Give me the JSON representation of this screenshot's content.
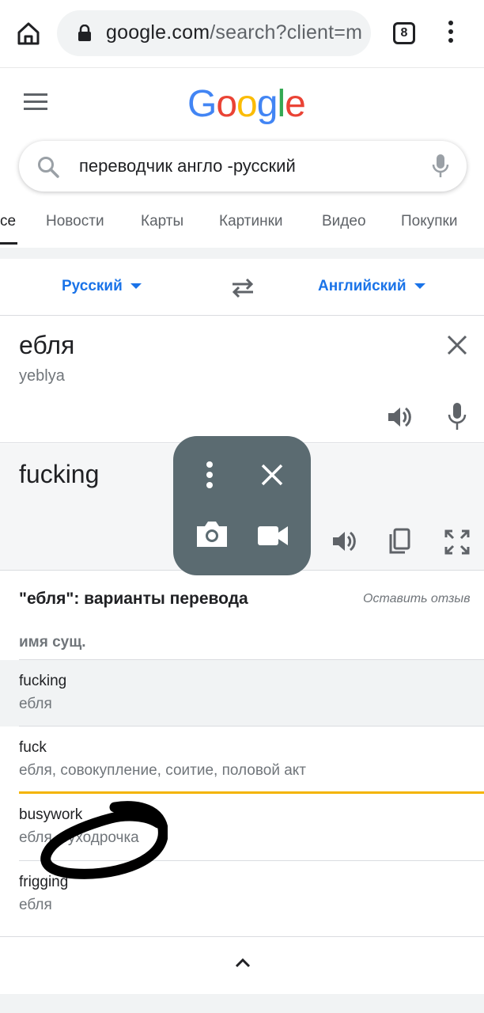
{
  "browser": {
    "url_domain": "google.com",
    "url_rest": "/search?client=m",
    "tab_count": "8"
  },
  "search": {
    "query": "переводчик англо -русский"
  },
  "nav_tabs": [
    "се",
    "Новости",
    "Карты",
    "Картинки",
    "Видео",
    "Покупки"
  ],
  "translate": {
    "source_lang": "Русский",
    "target_lang": "Английский",
    "source_text": "ебля",
    "transliteration": "yeblya",
    "translation": "fucking"
  },
  "variants": {
    "heading": "\"ебля\": варианты перевода",
    "feedback_link": "Оставить отзыв",
    "part_of_speech": "имя сущ.",
    "items": [
      {
        "term": "fucking",
        "synonyms": "ебля"
      },
      {
        "term": "fuck",
        "synonyms": "ебля, совокупление, соитие, половой акт"
      },
      {
        "term": "busywork",
        "synonyms": "ебля, суходрочка"
      },
      {
        "term": "frigging",
        "synonyms": "ебля"
      }
    ]
  },
  "colors": {
    "accent": "#1a73e8",
    "overlay": "#5b6b71",
    "highlight_line": "#f4b400"
  }
}
